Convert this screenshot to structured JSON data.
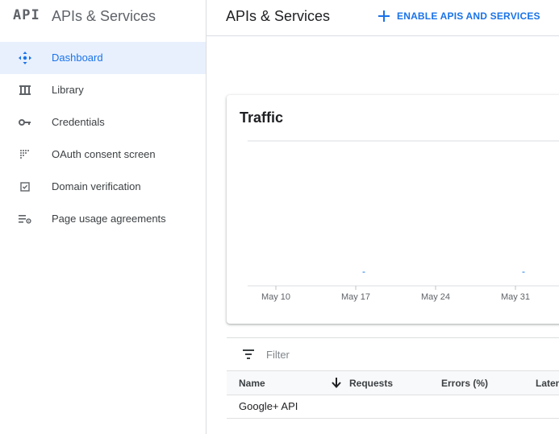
{
  "app": {
    "logo_text": "API",
    "title": "APIs & Services"
  },
  "sidebar": {
    "items": [
      {
        "label": "Dashboard",
        "icon": "dashboard-icon",
        "active": true
      },
      {
        "label": "Library",
        "icon": "library-icon",
        "active": false
      },
      {
        "label": "Credentials",
        "icon": "key-icon",
        "active": false
      },
      {
        "label": "OAuth consent screen",
        "icon": "oauth-consent-icon",
        "active": false
      },
      {
        "label": "Domain verification",
        "icon": "domain-verification-icon",
        "active": false
      },
      {
        "label": "Page usage agreements",
        "icon": "page-usage-icon",
        "active": false
      }
    ]
  },
  "header": {
    "page_title": "APIs & Services",
    "enable_button_label": "ENABLE APIS AND SERVICES",
    "enable_button_icon": "plus-icon"
  },
  "traffic": {
    "title": "Traffic"
  },
  "chart_data": {
    "type": "line",
    "title": "Traffic",
    "xlabel": "",
    "ylabel": "",
    "x_ticks": [
      "May 10",
      "May 17",
      "May 24",
      "May 31"
    ],
    "series": [],
    "markers": [
      {
        "x": "May 17",
        "label": "-"
      },
      {
        "x": "May 31",
        "label": "-"
      }
    ],
    "grid": true,
    "colors": {
      "axis": "#dadce0",
      "marker": "#1a73e8"
    }
  },
  "table": {
    "filter_placeholder": "Filter",
    "filter_icon": "filter-list-icon",
    "sort_icon": "arrow-down-icon",
    "columns": [
      "Name",
      "Requests",
      "Errors (%)",
      "Laten"
    ],
    "rows": [
      {
        "name": "Google+ API"
      }
    ]
  },
  "colors": {
    "accent": "#1a73e8",
    "active_bg": "#e8f0fe",
    "divider": "#dadce0"
  }
}
